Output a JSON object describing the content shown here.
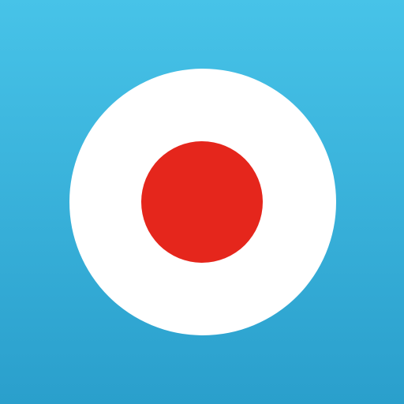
{
  "icon": {
    "name": "record-button-icon",
    "colors": {
      "background_top": "#47C3E8",
      "background_bottom": "#2A9FCC",
      "outer_ring": "#FFFFFF",
      "inner_dot": "#E5261C"
    }
  }
}
